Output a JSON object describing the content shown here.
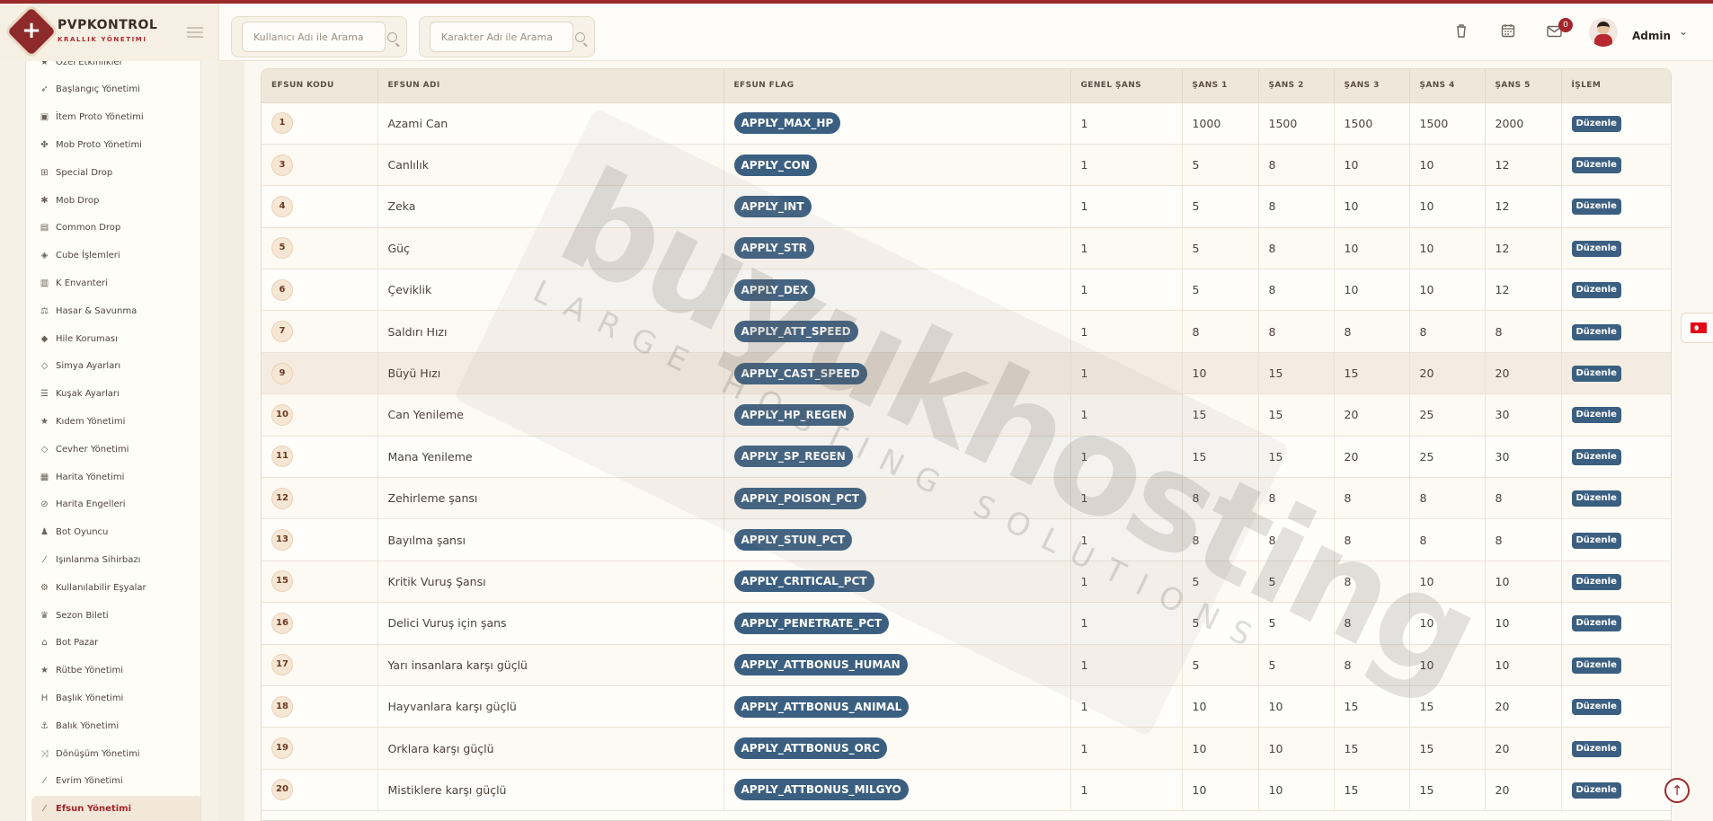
{
  "brand": {
    "title": "PVPKONTROL",
    "subtitle": "KRALLIK YÖNETIMI"
  },
  "search": {
    "user_placeholder": "Kullanıcı Adı ile Arama",
    "character_placeholder": "Karakter Adı ile Arama"
  },
  "header": {
    "notification_count": "0",
    "user_name": "Admin"
  },
  "sidebar": {
    "items": [
      {
        "label": "Özel Etkinlikler",
        "icon": "star-icon"
      },
      {
        "label": "Başlangıç Yönetimi",
        "icon": "rocket-icon"
      },
      {
        "label": "İtem Proto Yönetimi",
        "icon": "box-icon"
      },
      {
        "label": "Mob Proto Yönetimi",
        "icon": "paw-icon"
      },
      {
        "label": "Special Drop",
        "icon": "gift-icon"
      },
      {
        "label": "Mob Drop",
        "icon": "bug-icon"
      },
      {
        "label": "Common Drop",
        "icon": "table-icon"
      },
      {
        "label": "Cube İşlemleri",
        "icon": "cube-icon"
      },
      {
        "label": "K Envanteri",
        "icon": "book-icon"
      },
      {
        "label": "Hasar & Savunma",
        "icon": "scale-icon"
      },
      {
        "label": "Hile Koruması",
        "icon": "shield-icon"
      },
      {
        "label": "Simya Ayarları",
        "icon": "gem-icon"
      },
      {
        "label": "Kuşak Ayarları",
        "icon": "sliders-icon"
      },
      {
        "label": "Kıdem Yönetimi",
        "icon": "star-icon"
      },
      {
        "label": "Cevher Yönetimi",
        "icon": "gem-icon"
      },
      {
        "label": "Harita Yönetimi",
        "icon": "map-icon"
      },
      {
        "label": "Harita Engelleri",
        "icon": "ban-icon"
      },
      {
        "label": "Bot Oyuncu",
        "icon": "android-icon"
      },
      {
        "label": "Işınlanma Sihirbazı",
        "icon": "wand-icon"
      },
      {
        "label": "Kullanılabilir Eşyalar",
        "icon": "cogs-icon"
      },
      {
        "label": "Sezon Bileti",
        "icon": "trophy-icon"
      },
      {
        "label": "Bot Pazar",
        "icon": "store-icon"
      },
      {
        "label": "Rütbe Yönetimi",
        "icon": "star-icon"
      },
      {
        "label": "Başlık Yönetimi",
        "icon": "heading-icon"
      },
      {
        "label": "Balık Yönetimi",
        "icon": "anchor-icon"
      },
      {
        "label": "Dönüşüm Yönetimi",
        "icon": "shuffle-icon"
      },
      {
        "label": "Evrim Yönetimi",
        "icon": "wand-icon"
      },
      {
        "label": "Efsun Yönetimi",
        "icon": "wand-icon"
      }
    ]
  },
  "table": {
    "headers": [
      "EFSUN KODU",
      "EFSUN ADI",
      "EFSUN FLAG",
      "GENEL ŞANS",
      "ŞANS 1",
      "ŞANS 2",
      "ŞANS 3",
      "ŞANS 4",
      "ŞANS 5",
      "İŞLEM"
    ],
    "action_label": "Düzenle",
    "rows": [
      {
        "code": "1",
        "name": "Azami Can",
        "flag": "APPLY_MAX_HP",
        "general": "1",
        "s1": "1000",
        "s2": "1500",
        "s3": "1500",
        "s4": "1500",
        "s5": "2000"
      },
      {
        "code": "3",
        "name": "Canlılık",
        "flag": "APPLY_CON",
        "general": "1",
        "s1": "5",
        "s2": "8",
        "s3": "10",
        "s4": "10",
        "s5": "12"
      },
      {
        "code": "4",
        "name": "Zeka",
        "flag": "APPLY_INT",
        "general": "1",
        "s1": "5",
        "s2": "8",
        "s3": "10",
        "s4": "10",
        "s5": "12"
      },
      {
        "code": "5",
        "name": "Güç",
        "flag": "APPLY_STR",
        "general": "1",
        "s1": "5",
        "s2": "8",
        "s3": "10",
        "s4": "10",
        "s5": "12"
      },
      {
        "code": "6",
        "name": "Çeviklik",
        "flag": "APPLY_DEX",
        "general": "1",
        "s1": "5",
        "s2": "8",
        "s3": "10",
        "s4": "10",
        "s5": "12"
      },
      {
        "code": "7",
        "name": "Saldırı Hızı",
        "flag": "APPLY_ATT_SPEED",
        "general": "1",
        "s1": "8",
        "s2": "8",
        "s3": "8",
        "s4": "8",
        "s5": "8"
      },
      {
        "code": "9",
        "name": "Büyü Hızı",
        "flag": "APPLY_CAST_SPEED",
        "general": "1",
        "s1": "10",
        "s2": "15",
        "s3": "15",
        "s4": "20",
        "s5": "20"
      },
      {
        "code": "10",
        "name": "Can Yenileme",
        "flag": "APPLY_HP_REGEN",
        "general": "1",
        "s1": "15",
        "s2": "15",
        "s3": "20",
        "s4": "25",
        "s5": "30"
      },
      {
        "code": "11",
        "name": "Mana Yenileme",
        "flag": "APPLY_SP_REGEN",
        "general": "1",
        "s1": "15",
        "s2": "15",
        "s3": "20",
        "s4": "25",
        "s5": "30"
      },
      {
        "code": "12",
        "name": "Zehirleme şansı",
        "flag": "APPLY_POISON_PCT",
        "general": "1",
        "s1": "8",
        "s2": "8",
        "s3": "8",
        "s4": "8",
        "s5": "8"
      },
      {
        "code": "13",
        "name": "Bayılma şansı",
        "flag": "APPLY_STUN_PCT",
        "general": "1",
        "s1": "8",
        "s2": "8",
        "s3": "8",
        "s4": "8",
        "s5": "8"
      },
      {
        "code": "15",
        "name": "Kritik Vuruş Şansı",
        "flag": "APPLY_CRITICAL_PCT",
        "general": "1",
        "s1": "5",
        "s2": "5",
        "s3": "8",
        "s4": "10",
        "s5": "10"
      },
      {
        "code": "16",
        "name": "Delici Vuruş için şans",
        "flag": "APPLY_PENETRATE_PCT",
        "general": "1",
        "s1": "5",
        "s2": "5",
        "s3": "8",
        "s4": "10",
        "s5": "10"
      },
      {
        "code": "17",
        "name": "Yarı insanlara karşı güçlü",
        "flag": "APPLY_ATTBONUS_HUMAN",
        "general": "1",
        "s1": "5",
        "s2": "5",
        "s3": "8",
        "s4": "10",
        "s5": "10"
      },
      {
        "code": "18",
        "name": "Hayvanlara karşı güçlü",
        "flag": "APPLY_ATTBONUS_ANIMAL",
        "general": "1",
        "s1": "10",
        "s2": "10",
        "s3": "15",
        "s4": "15",
        "s5": "20"
      },
      {
        "code": "19",
        "name": "Orklara karşı güçlü",
        "flag": "APPLY_ATTBONUS_ORC",
        "general": "1",
        "s1": "10",
        "s2": "10",
        "s3": "15",
        "s4": "15",
        "s5": "20"
      },
      {
        "code": "20",
        "name": "Mistiklere karşı güçlü",
        "flag": "APPLY_ATTBONUS_MILGYO",
        "general": "1",
        "s1": "10",
        "s2": "10",
        "s3": "15",
        "s4": "15",
        "s5": "20"
      }
    ]
  },
  "watermark": {
    "brand": "buyukhosting",
    "tagline": "LARGE HOSTING SOLUTIONS"
  },
  "colors": {
    "accent": "#9b2b2b",
    "pill": "#3b5f80",
    "badge": "#a3262c"
  }
}
